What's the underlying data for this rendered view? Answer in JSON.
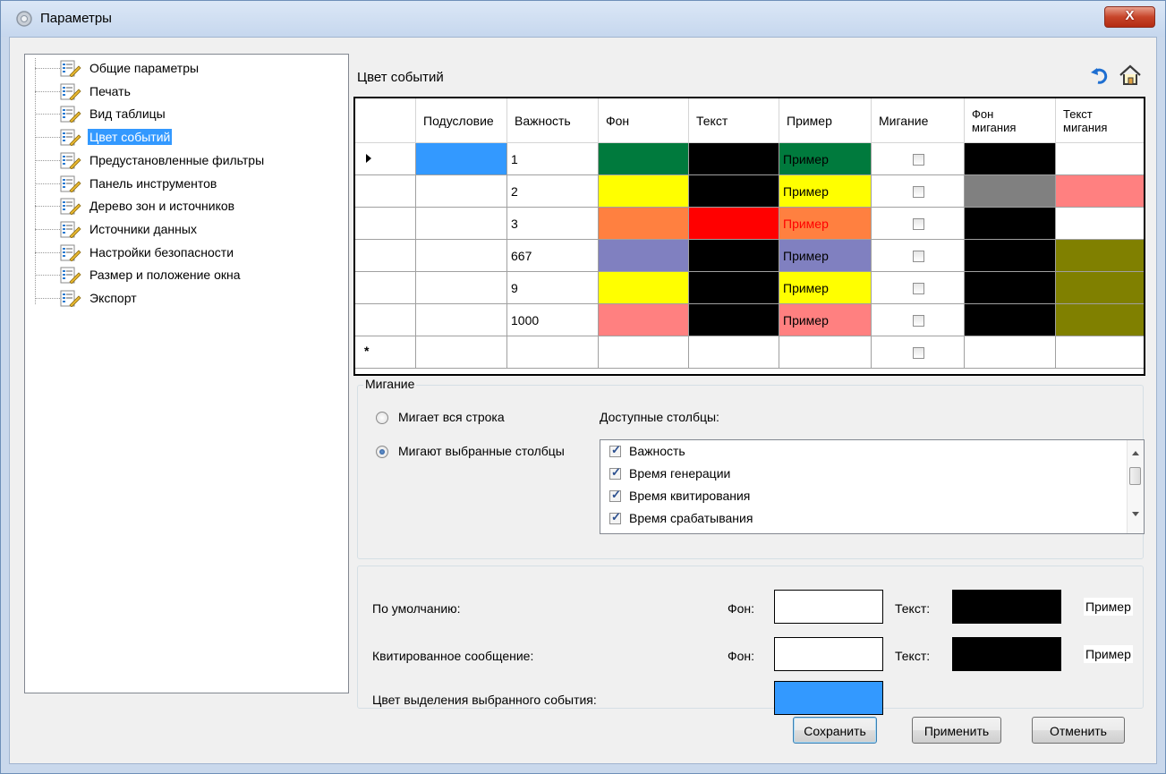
{
  "window": {
    "title": "Параметры",
    "close_label": "X"
  },
  "tree": {
    "items": [
      {
        "label": "Общие параметры",
        "selected": false
      },
      {
        "label": "Печать",
        "selected": false
      },
      {
        "label": "Вид таблицы",
        "selected": false
      },
      {
        "label": "Цвет событий",
        "selected": true
      },
      {
        "label": "Предустановленные фильтры",
        "selected": false
      },
      {
        "label": "Панель инструментов",
        "selected": false
      },
      {
        "label": "Дерево зон и источников",
        "selected": false
      },
      {
        "label": "Источники  данных",
        "selected": false
      },
      {
        "label": "Настройки безопасности",
        "selected": false
      },
      {
        "label": "Размер и положение окна",
        "selected": false
      },
      {
        "label": "Экспорт",
        "selected": false
      }
    ]
  },
  "section_title": "Цвет событий",
  "grid": {
    "headers": [
      "Подусловие",
      "Важность",
      "Фон",
      "Текст",
      "Пример",
      "Мигание",
      "Фон мигания",
      "Текст мигания"
    ],
    "sample_label": "Пример",
    "rows": [
      {
        "current": true,
        "sub_color": "#3399ff",
        "importance": "1",
        "bg": "#007a3d",
        "text": "#000000",
        "sample_fg": "#000000",
        "blink": false,
        "blink_bg": "#000000",
        "blink_text": "#ffffff"
      },
      {
        "current": false,
        "sub_color": "#ffffff",
        "importance": "2",
        "bg": "#ffff00",
        "text": "#000000",
        "sample_fg": "#000000",
        "blink": false,
        "blink_bg": "#808080",
        "blink_text": "#ff8080"
      },
      {
        "current": false,
        "sub_color": "#ffffff",
        "importance": "3",
        "bg": "#ff8040",
        "text": "#ff0000",
        "sample_fg": "#ff0000",
        "blink": false,
        "blink_bg": "#000000",
        "blink_text": "#ffffff"
      },
      {
        "current": false,
        "sub_color": "#ffffff",
        "importance": "667",
        "bg": "#8080c0",
        "text": "#000000",
        "sample_fg": "#000000",
        "blink": false,
        "blink_bg": "#000000",
        "blink_text": "#808000"
      },
      {
        "current": false,
        "sub_color": "#ffffff",
        "importance": "9",
        "bg": "#ffff00",
        "text": "#000000",
        "sample_fg": "#000000",
        "blink": false,
        "blink_bg": "#000000",
        "blink_text": "#808000"
      },
      {
        "current": false,
        "sub_color": "#ffffff",
        "importance": "1000",
        "bg": "#ff8080",
        "text": "#000000",
        "sample_fg": "#000000",
        "blink": false,
        "blink_bg": "#000000",
        "blink_text": "#808000"
      }
    ],
    "new_row_marker": "*"
  },
  "blink": {
    "legend": "Мигание",
    "option_row": "Мигает вся строка",
    "option_columns": "Мигают выбранные столбцы",
    "selected_option": "columns",
    "available_label": "Доступные столбцы:",
    "columns": [
      {
        "label": "Важность",
        "checked": true
      },
      {
        "label": "Время генерации",
        "checked": true
      },
      {
        "label": "Время квитирования",
        "checked": true
      },
      {
        "label": "Время срабатывания",
        "checked": true
      }
    ]
  },
  "defaults": {
    "default_label": "По умолчанию:",
    "ack_label": "Квитированное сообщение:",
    "highlight_label": "Цвет выделения выбранного события:",
    "bg_label": "Фон:",
    "text_label": "Текст:",
    "sample": "Пример",
    "default_bg": "#ffffff",
    "default_text": "#000000",
    "ack_bg": "#ffffff",
    "ack_text": "#000000",
    "highlight_color": "#3399ff"
  },
  "buttons": {
    "save": "Сохранить",
    "apply": "Применить",
    "cancel": "Отменить"
  }
}
